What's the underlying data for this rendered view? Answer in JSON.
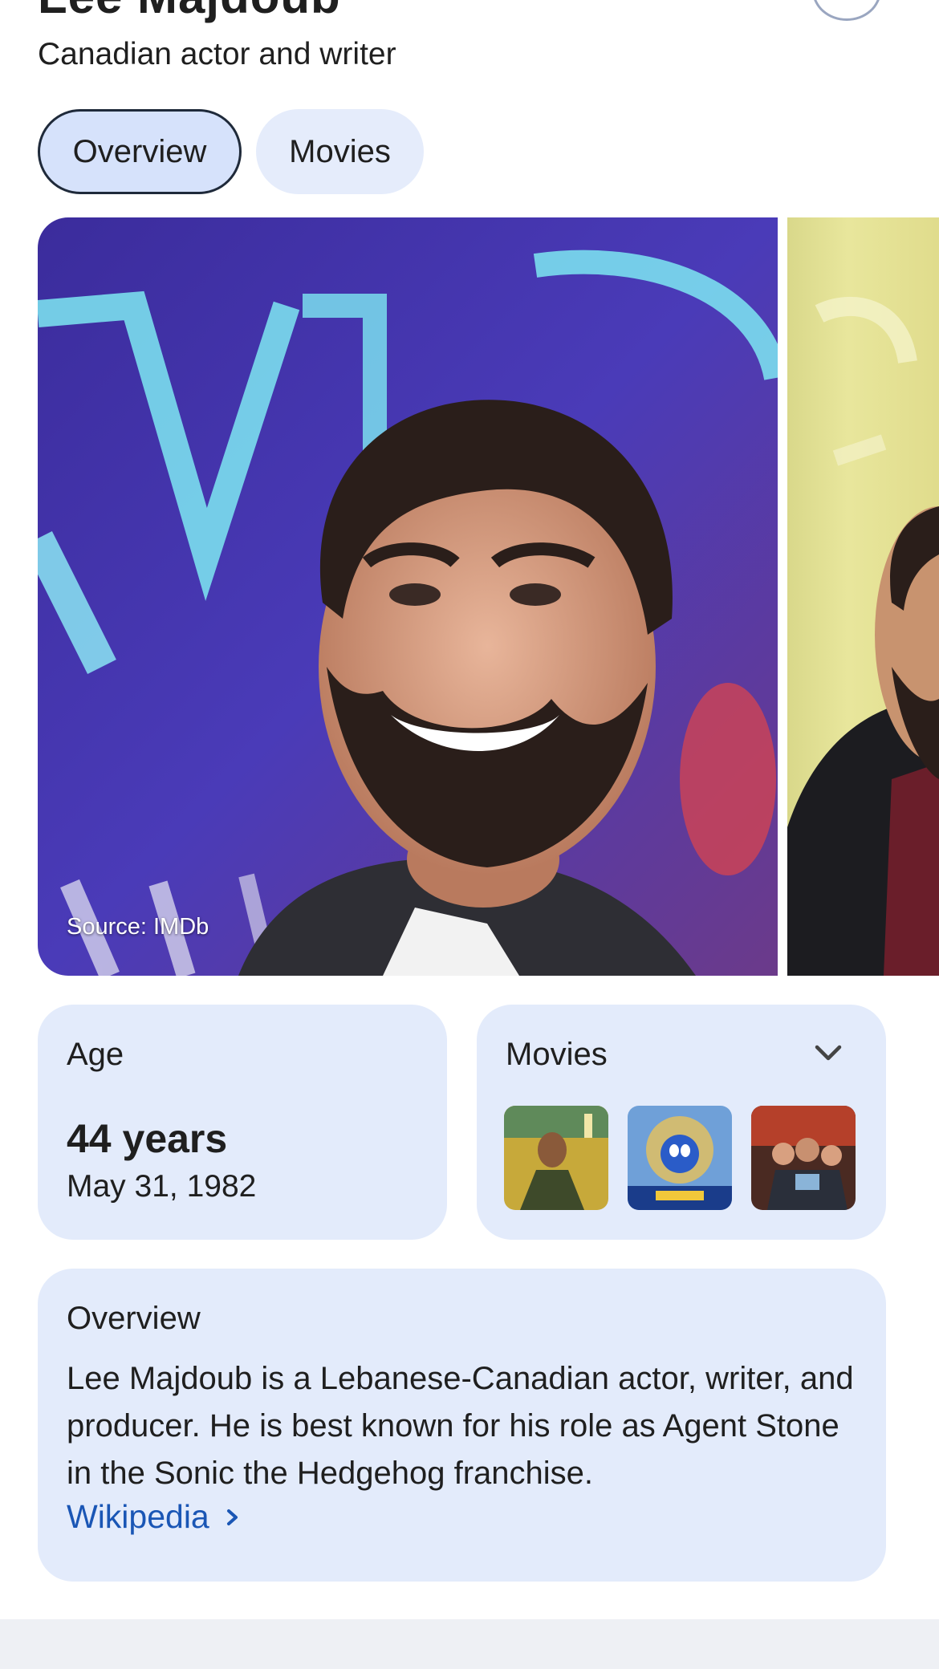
{
  "entity": {
    "title": "Lee Majdoub",
    "subtitle": "Canadian actor and writer"
  },
  "tabs": [
    {
      "label": "Overview",
      "active": true
    },
    {
      "label": "Movies",
      "active": false
    }
  ],
  "gallery": {
    "source_label": "Source: IMDb"
  },
  "age_card": {
    "label": "Age",
    "value": "44 years",
    "date": "May 31, 1982"
  },
  "movies_card": {
    "label": "Movies",
    "expand_icon": "chevron-down-icon"
  },
  "overview_card": {
    "label": "Overview",
    "text": "Lee Majdoub is a Lebanese-Canadian actor, writer, and producer. He is best known for his role as Agent Stone in the Sonic the Hedgehog franchise.",
    "link_label": "Wikipedia",
    "link_icon": "chevron-right-icon"
  },
  "colors": {
    "card_bg": "#e3ebfb",
    "link": "#1a56b5",
    "active_tab_border": "#1f2a3a"
  }
}
